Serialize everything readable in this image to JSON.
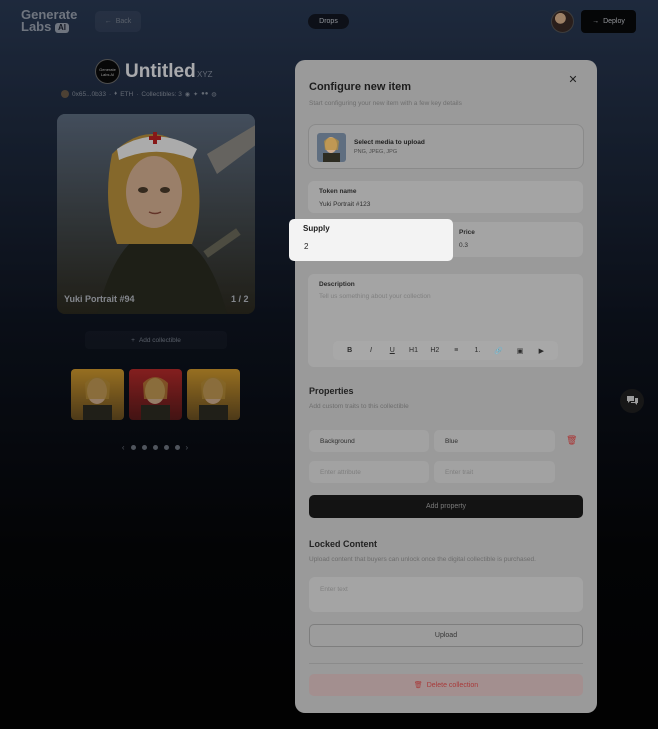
{
  "header": {
    "logo_line1": "Generate",
    "logo_line2": "Labs",
    "logo_badge": "AI",
    "back_label": "Back",
    "center_pill": "Drops",
    "deploy_label": "Deploy"
  },
  "collection": {
    "logo_text": "Generate Labs AI",
    "title": "Untitled",
    "suffix": "XYZ",
    "address": "0x65...0b33",
    "chain": "ETH",
    "collectibles": "Collectibles: 3"
  },
  "preview_card": {
    "name": "Yuki Portrait #94",
    "count": "1 / 2"
  },
  "add_collectible_label": "Add collectible",
  "modal": {
    "title": "Configure new item",
    "subtitle": "Start configuring your new item with a few key details",
    "upload_label": "Select media to upload",
    "upload_types": "PNG, JPEG, JPG",
    "token_name_label": "Token name",
    "token_name_value": "Yuki Portrait #123",
    "price_label": "Price",
    "price_value": "0.3",
    "description_label": "Description",
    "description_placeholder": "Tell us something about your collection",
    "toolbar": [
      "B",
      "I",
      "U",
      "H1",
      "H2",
      "≡",
      "1.",
      "🔗",
      "▣",
      "▶"
    ],
    "properties_title": "Properties",
    "properties_sub": "Add custom traits to this collectible",
    "property_key": "Background",
    "property_value": "Blue",
    "attr_placeholder": "Enter attribute",
    "value_placeholder": "Enter trait",
    "add_property_label": "Add property",
    "locked_title": "Locked Content",
    "locked_sub": "Upload content that buyers can unlock once the digital collectible is purchased.",
    "locked_placeholder": "Enter text",
    "upload_button": "Upload",
    "delete_label": "Delete collection"
  },
  "supply": {
    "label": "Supply",
    "value": "2"
  },
  "colors": {
    "accent_dark": "#131313",
    "modal_bg": "#9a9a9a",
    "danger": "#a83a3a",
    "highlight_bg": "#f3f3f3"
  }
}
